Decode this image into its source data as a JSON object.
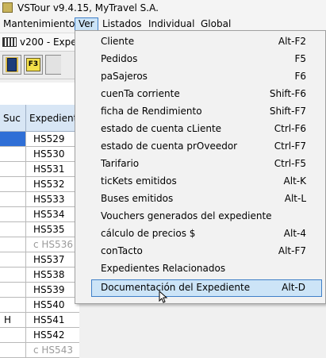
{
  "window": {
    "title": "VSTour v9.4.15, MyTravel S.A."
  },
  "menubar": {
    "items": [
      "Mantenimiento",
      "Ver",
      "Listados",
      "Individual",
      "Global"
    ]
  },
  "subwindow": {
    "title": "v200 - Expedi"
  },
  "toolbar": {
    "f3_label": "F3"
  },
  "grid": {
    "columns": [
      "Suc",
      "Expediente"
    ],
    "rows": [
      {
        "suc": "",
        "exp": "HS529",
        "selected": true
      },
      {
        "suc": "",
        "exp": "HS530"
      },
      {
        "suc": "",
        "exp": "HS531"
      },
      {
        "suc": "",
        "exp": "HS532"
      },
      {
        "suc": "",
        "exp": "HS533"
      },
      {
        "suc": "",
        "exp": "HS534"
      },
      {
        "suc": "",
        "exp": "HS535"
      },
      {
        "suc": "",
        "exp": "c HS536",
        "dim": true
      },
      {
        "suc": "",
        "exp": "HS537"
      },
      {
        "suc": "",
        "exp": "HS538"
      },
      {
        "suc": "",
        "exp": "HS539"
      },
      {
        "suc": "",
        "exp": "HS540"
      },
      {
        "suc": "H",
        "exp": "HS541"
      },
      {
        "suc": "",
        "exp": "HS542"
      },
      {
        "suc": "",
        "exp": "c HS543",
        "dim": true
      }
    ]
  },
  "ver_menu": {
    "items": [
      {
        "label": "Cliente",
        "shortcut": "Alt-F2"
      },
      {
        "label": "Pedidos",
        "shortcut": "F5"
      },
      {
        "label": "paSajeros",
        "shortcut": "F6"
      },
      {
        "label": "cuenTa corriente",
        "shortcut": "Shift-F6"
      },
      {
        "label": "ficha de Rendimiento",
        "shortcut": "Shift-F7"
      },
      {
        "label": "estado de cuenta cLiente",
        "shortcut": "Ctrl-F6"
      },
      {
        "label": "estado de cuenta prOveedor",
        "shortcut": "Ctrl-F7"
      },
      {
        "label": "Tarifario",
        "shortcut": "Ctrl-F5"
      },
      {
        "label": "ticKets emitidos",
        "shortcut": "Alt-K"
      },
      {
        "label": "Buses emitidos",
        "shortcut": "Alt-L"
      },
      {
        "label": "Vouchers generados del expediente",
        "shortcut": ""
      },
      {
        "label": "cálculo de precios $",
        "shortcut": "Alt-4"
      },
      {
        "label": "conTacto",
        "shortcut": "Alt-F7"
      },
      {
        "label": "Expedientes Relacionados",
        "shortcut": ""
      },
      {
        "label": "Documentación del Expediente",
        "shortcut": "Alt-D",
        "highlighted": true
      }
    ]
  },
  "colors": {
    "accent": "#3f7fc8",
    "highlight_bg": "#cce4f7",
    "selection": "#2f6fd6",
    "header_bg": "#d8e6f5"
  }
}
